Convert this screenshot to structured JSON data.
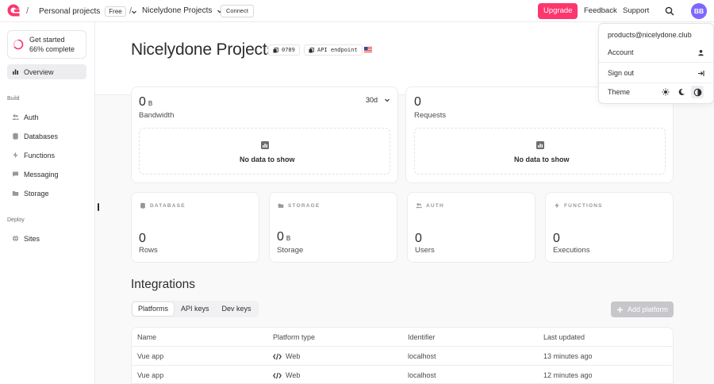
{
  "topbar": {
    "org": "Personal projects",
    "plan_badge": "Free",
    "project": "Nicelydone Projects",
    "connect": "Connect",
    "upgrade": "Upgrade",
    "feedback": "Feedback",
    "support": "Support",
    "avatar_initials": "BB",
    "brand_color": "#fd366e",
    "avatar_color": "#7c67fe"
  },
  "sidebar": {
    "get_started": {
      "title": "Get started",
      "progress_text": "66% complete",
      "progress": 0.66
    },
    "overview": "Overview",
    "build_label": "Build",
    "build_items": [
      "Auth",
      "Databases",
      "Functions",
      "Messaging",
      "Storage"
    ],
    "deploy_label": "Deploy",
    "deploy_items": [
      "Sites"
    ]
  },
  "header": {
    "title": "Nicelydone Projects",
    "project_id": "0789",
    "api_endpoint": "API endpoint"
  },
  "stats": {
    "bandwidth": {
      "value": "0",
      "unit": "B",
      "label": "Bandwidth",
      "range": "30d",
      "empty": "No data to show"
    },
    "requests": {
      "value": "0",
      "label": "Requests",
      "empty": "No data to show"
    },
    "database": {
      "heading": "DATABASE",
      "value": "0",
      "label": "Rows"
    },
    "storage": {
      "heading": "STORAGE",
      "value": "0",
      "unit": "B",
      "label": "Storage"
    },
    "auth": {
      "heading": "AUTH",
      "value": "0",
      "label": "Users"
    },
    "functions": {
      "heading": "FUNCTIONS",
      "value": "0",
      "label": "Executions"
    }
  },
  "integrations": {
    "title": "Integrations",
    "tabs": [
      "Platforms",
      "API keys",
      "Dev keys"
    ],
    "add_button": "Add platform",
    "columns": [
      "Name",
      "Platform type",
      "Identifier",
      "Last updated"
    ],
    "rows": [
      {
        "name": "Vue app",
        "type": "Web",
        "identifier": "localhost",
        "updated": "13 minutes ago"
      },
      {
        "name": "Vue app",
        "type": "Web",
        "identifier": "localhost",
        "updated": "12 minutes ago"
      }
    ]
  },
  "dropdown": {
    "email": "products@nicelydone.club",
    "account": "Account",
    "sign_out": "Sign out",
    "theme": "Theme"
  }
}
